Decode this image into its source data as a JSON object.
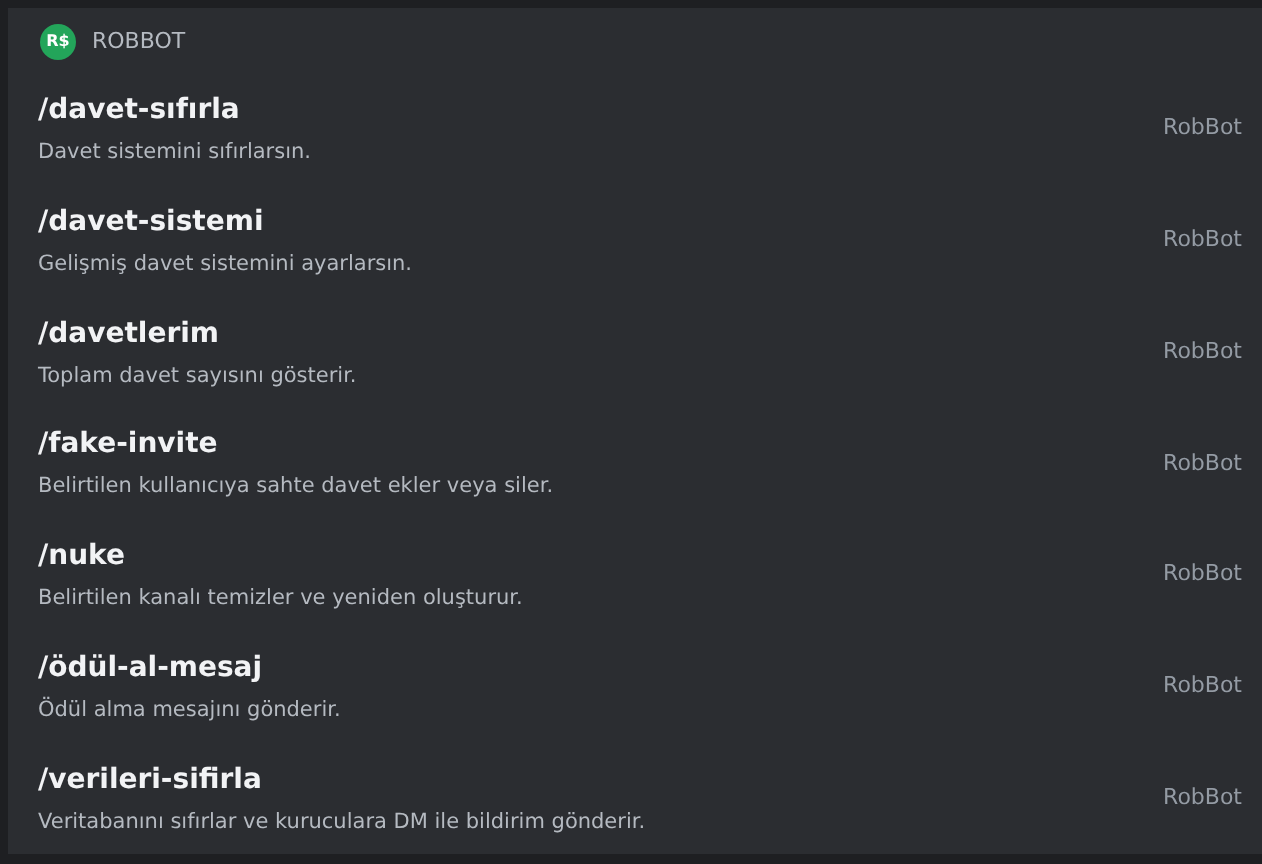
{
  "app": {
    "logo_text": "R$",
    "name": "ROBBOT"
  },
  "commands": [
    {
      "name": "/davet-sıfırla",
      "description": "Davet sistemini sıfırlarsın.",
      "source": "RobBot"
    },
    {
      "name": "/davet-sistemi",
      "description": "Gelişmiş davet sistemini ayarlarsın.",
      "source": "RobBot"
    },
    {
      "name": "/davetlerim",
      "description": "Toplam davet sayısını gösterir.",
      "source": "RobBot"
    },
    {
      "name": "/fake-invite",
      "description": "Belirtilen kullanıcıya sahte davet ekler veya siler.",
      "source": "RobBot"
    },
    {
      "name": "/nuke",
      "description": "Belirtilen kanalı temizler ve yeniden oluşturur.",
      "source": "RobBot"
    },
    {
      "name": "/ödül-al-mesaj",
      "description": "Ödül alma mesajını gönderir.",
      "source": "RobBot"
    },
    {
      "name": "/verileri-sifirla",
      "description": "Veritabanını sıfırlar ve kuruculara DM ile bildirim gönderir.",
      "source": "RobBot"
    }
  ]
}
